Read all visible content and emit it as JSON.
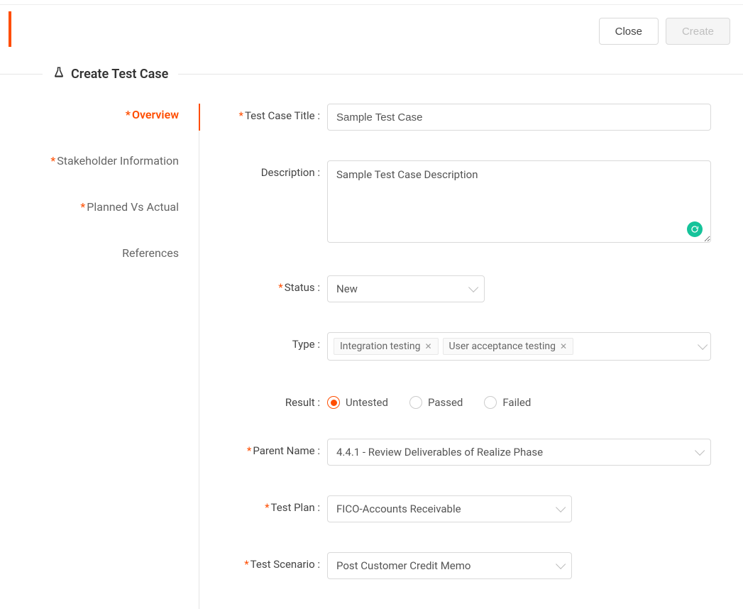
{
  "header": {
    "close_label": "Close",
    "create_label": "Create"
  },
  "section_title": "Create Test Case",
  "sidebar": {
    "items": [
      {
        "label": "Overview",
        "required": true,
        "active": true
      },
      {
        "label": "Stakeholder Information",
        "required": true,
        "active": false
      },
      {
        "label": "Planned Vs Actual",
        "required": true,
        "active": false
      },
      {
        "label": "References",
        "required": false,
        "active": false
      }
    ]
  },
  "form": {
    "title": {
      "label": "Test Case Title :",
      "value": "Sample Test Case"
    },
    "description": {
      "label": "Description :",
      "value": "Sample Test Case Description"
    },
    "status": {
      "label": "Status :",
      "value": "New"
    },
    "type": {
      "label": "Type :",
      "tags": [
        "Integration testing",
        "User acceptance testing"
      ]
    },
    "result": {
      "label": "Result :",
      "options": [
        "Untested",
        "Passed",
        "Failed"
      ],
      "selected": "Untested"
    },
    "parent_name": {
      "label": "Parent Name :",
      "value": "4.4.1 - Review Deliverables of Realize Phase"
    },
    "test_plan": {
      "label": "Test Plan :",
      "value": "FICO-Accounts Receivable"
    },
    "test_scenario": {
      "label": "Test Scenario :",
      "value": "Post Customer Credit Memo"
    }
  }
}
